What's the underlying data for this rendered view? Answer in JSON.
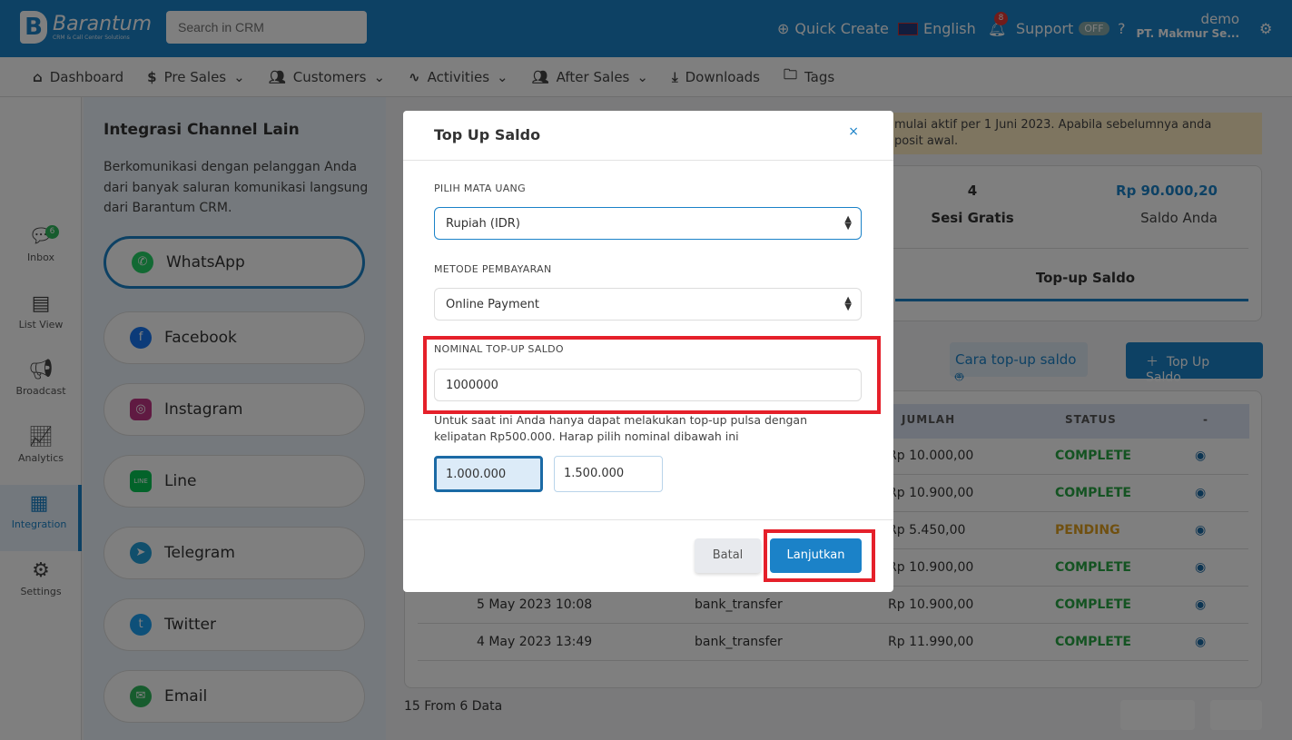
{
  "header": {
    "brand": "Barantum",
    "brand_sub": "CRM & Call Center Solutions",
    "search_placeholder": "Search in CRM",
    "quick_create": "Quick Create",
    "language": "English",
    "notifications": "8",
    "support": "Support",
    "support_state": "OFF",
    "user": "demo",
    "company": "PT. Makmur Se..."
  },
  "nav": [
    "Dashboard",
    "Pre Sales",
    "Customers",
    "Activities",
    "After Sales",
    "Downloads",
    "Tags"
  ],
  "sidebar": [
    {
      "label": "Inbox",
      "badge": "6"
    },
    {
      "label": "List View"
    },
    {
      "label": "Broadcast"
    },
    {
      "label": "Analytics"
    },
    {
      "label": "Integration"
    },
    {
      "label": "Settings"
    }
  ],
  "channels": {
    "title": "Integrasi Channel Lain",
    "desc": "Berkomunikasi dengan pelanggan Anda dari banyak saluran komunikasi langsung dari Barantum CRM.",
    "items": [
      "WhatsApp",
      "Facebook",
      "Instagram",
      "Line",
      "Telegram",
      "Twitter",
      "Email"
    ]
  },
  "banner": "mulai aktif per 1 Juni 2023. Apabila sebelumnya anda ... posit awal.",
  "banner_l1": "mulai aktif per 1 Juni 2023. Apabila sebelumnya anda",
  "banner_l2": "posit awal.",
  "stats": {
    "sesi_value": "4",
    "sesi_label": "Sesi Gratis",
    "saldo_value": "Rp 90.000,20",
    "saldo_label": "Saldo Anda",
    "tab": "Top-up Saldo"
  },
  "actions": {
    "howto": "Cara top-up saldo",
    "topup": "Top Up Saldo"
  },
  "table": {
    "headers": [
      "JUMLAH",
      "STATUS",
      "-"
    ],
    "rows": [
      {
        "date": "",
        "method": "",
        "amount": "Rp 10.000,00",
        "status": "COMPLETE"
      },
      {
        "date": "",
        "method": "",
        "amount": "Rp 10.900,00",
        "status": "COMPLETE"
      },
      {
        "date": "",
        "method": "",
        "amount": "Rp 5.450,00",
        "status": "PENDING"
      },
      {
        "date": "",
        "method": "",
        "amount": "Rp 10.900,00",
        "status": "COMPLETE"
      },
      {
        "date": "5 May 2023 10:08",
        "method": "bank_transfer",
        "amount": "Rp 10.900,00",
        "status": "COMPLETE"
      },
      {
        "date": "4 May 2023 13:49",
        "method": "bank_transfer",
        "amount": "Rp 11.990,00",
        "status": "COMPLETE"
      }
    ],
    "footer": "15 From 6 Data"
  },
  "modal": {
    "title": "Top Up Saldo",
    "currency_label": "PILIH MATA UANG",
    "currency": "Rupiah (IDR)",
    "method_label": "METODE PEMBAYARAN",
    "method": "Online Payment",
    "amount_label": "NOMINAL TOP-UP SALDO",
    "amount": "1000000",
    "note": "Untuk saat ini Anda hanya dapat melakukan top-up pulsa dengan kelipatan Rp500.000. Harap pilih nominal dibawah ini",
    "options": [
      "1.000.000",
      "1.500.000"
    ],
    "cancel": "Batal",
    "submit": "Lanjutkan"
  },
  "colors": {
    "primary": "#1b82c8",
    "highlight": "#e5202a",
    "complete": "#28a745",
    "pending": "#e0a020"
  }
}
